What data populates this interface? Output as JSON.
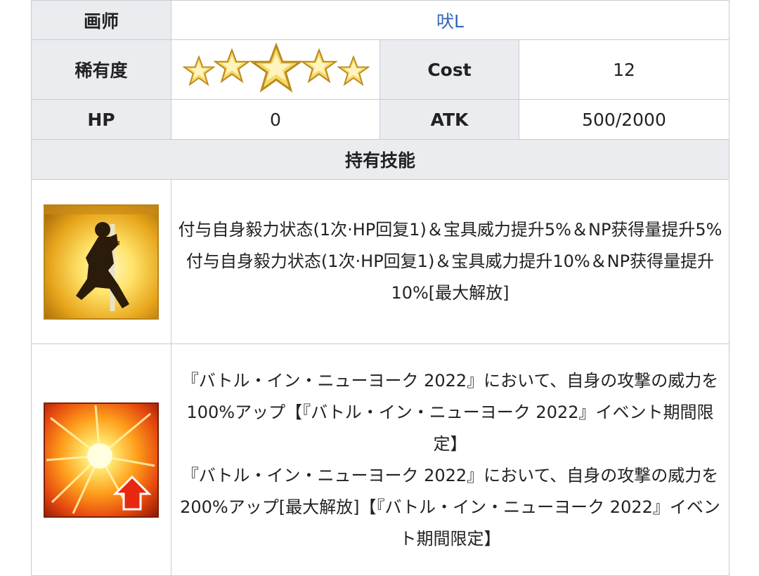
{
  "rows": {
    "illustrator": {
      "label": "画师",
      "value": "吠L"
    },
    "rarity": {
      "label": "稀有度",
      "stars": 5
    },
    "cost": {
      "label": "Cost",
      "value": "12"
    },
    "hp": {
      "label": "HP",
      "value": "0"
    },
    "atk": {
      "label": "ATK",
      "value": "500/2000"
    }
  },
  "skills": {
    "header": "持有技能",
    "items": [
      {
        "icon": "kneeling-swordsman-icon",
        "lines": [
          "付与自身毅力状态(1次·HP回复1)＆宝具威力提升5%＆NP获得量提升5%",
          "付与自身毅力状态(1次·HP回复1)＆宝具威力提升10%＆NP获得量提升10%[最大解放]"
        ]
      },
      {
        "icon": "attack-up-burst-icon",
        "lines": [
          "『バトル・イン・ニューヨーク 2022』において、自身の攻撃の威力を100%アップ【『バトル・イン・ニューヨーク 2022』イベント期間限定】",
          "『バトル・イン・ニューヨーク 2022』において、自身の攻撃の威力を200%アップ[最大解放]【『バトル・イン・ニューヨーク 2022』イベント期間限定】"
        ]
      }
    ]
  },
  "colors": {
    "header_bg": "#eaecf0",
    "border": "#c8ccd1",
    "link": "#3366bb",
    "star_gold": "#f3c94a"
  }
}
